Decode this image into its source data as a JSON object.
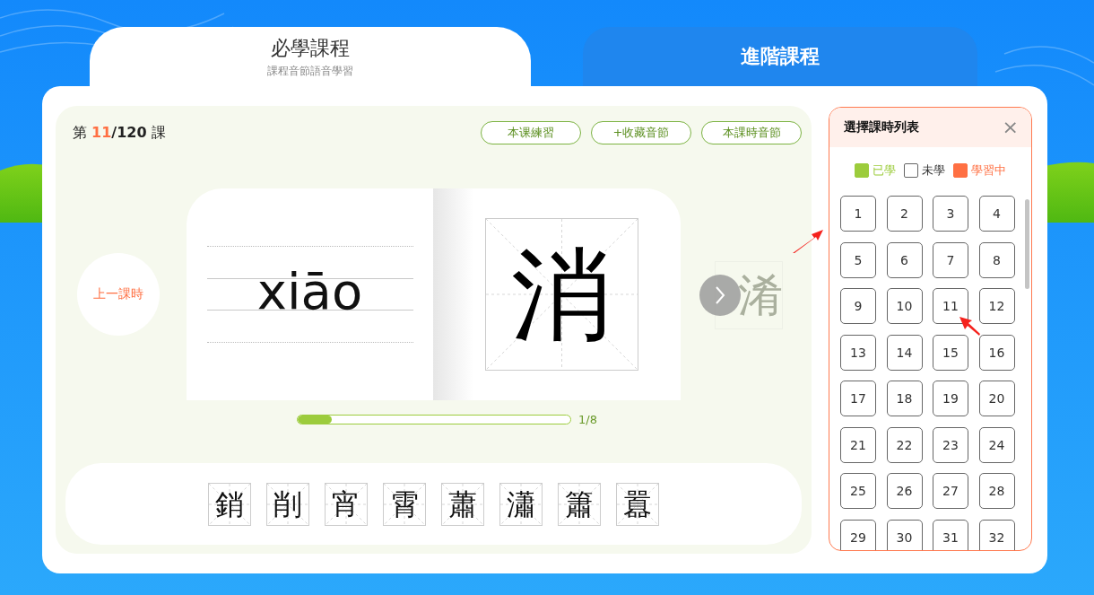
{
  "tabs": [
    {
      "title": "必學課程",
      "subtitle": "課程音節語音學習",
      "selected": true
    },
    {
      "title": "進階課程",
      "selected": false
    }
  ],
  "lesson": {
    "prefix": "第",
    "current": "11",
    "total": "/120",
    "suffix": "課"
  },
  "actions": [
    "本课練習",
    "+收藏音節",
    "本課時音節"
  ],
  "prev_button": "上一課時",
  "card": {
    "pinyin": "xiāo",
    "character": "消"
  },
  "next_preview": "淆",
  "progress": {
    "level": 0.125,
    "reading": "1/8"
  },
  "related": [
    "銷",
    "削",
    "宵",
    "霄",
    "蕭",
    "瀟",
    "簫",
    "囂"
  ],
  "picker": {
    "title": "選擇課時列表",
    "close": "×",
    "legend": [
      {
        "label": "已學",
        "kind": "learned"
      },
      {
        "label": "未學",
        "kind": "unlearned"
      },
      {
        "label": "學習中",
        "kind": "learning"
      }
    ],
    "lessons": [
      {
        "number": "1",
        "learned": false,
        "learning": false
      },
      {
        "number": "2",
        "learned": false,
        "learning": false
      },
      {
        "number": "3",
        "learned": false,
        "learning": false
      },
      {
        "number": "4",
        "learned": false,
        "learning": false
      },
      {
        "number": "5",
        "learned": false,
        "learning": false
      },
      {
        "number": "6",
        "learned": false,
        "learning": false
      },
      {
        "number": "7",
        "learned": false,
        "learning": false
      },
      {
        "number": "8",
        "learned": false,
        "learning": false
      },
      {
        "number": "9",
        "learned": false,
        "learning": false
      },
      {
        "number": "10",
        "learned": false,
        "learning": false
      },
      {
        "number": "11",
        "learned": false,
        "learning": false
      },
      {
        "number": "12",
        "learned": false,
        "learning": false
      },
      {
        "number": "13",
        "learned": false,
        "learning": false
      },
      {
        "number": "14",
        "learned": false,
        "learning": false
      },
      {
        "number": "15",
        "learned": false,
        "learning": false
      },
      {
        "number": "16",
        "learned": false,
        "learning": false
      },
      {
        "number": "17",
        "learned": false,
        "learning": false
      },
      {
        "number": "18",
        "learned": false,
        "learning": false
      },
      {
        "number": "19",
        "learned": false,
        "learning": false
      },
      {
        "number": "20",
        "learned": false,
        "learning": false
      },
      {
        "number": "21",
        "learned": false,
        "learning": false
      },
      {
        "number": "22",
        "learned": false,
        "learning": false
      },
      {
        "number": "23",
        "learned": false,
        "learning": false
      },
      {
        "number": "24",
        "learned": false,
        "learning": false
      },
      {
        "number": "25",
        "learned": false,
        "learning": false
      },
      {
        "number": "26",
        "learned": false,
        "learning": false
      },
      {
        "number": "27",
        "learned": false,
        "learning": false
      },
      {
        "number": "28",
        "learned": false,
        "learning": false
      },
      {
        "number": "29",
        "learned": false,
        "learning": false
      },
      {
        "number": "30",
        "learned": false,
        "learning": false
      },
      {
        "number": "31",
        "learned": false,
        "learning": false
      },
      {
        "number": "32",
        "learned": false,
        "learning": false
      }
    ]
  }
}
